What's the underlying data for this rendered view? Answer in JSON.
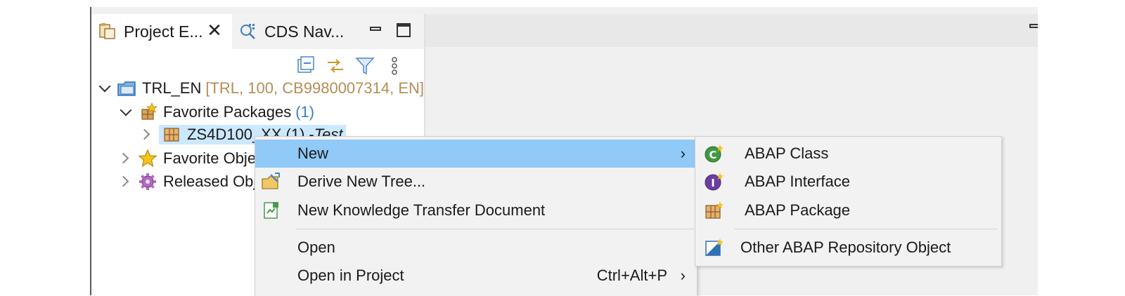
{
  "explorer": {
    "tabs": [
      {
        "label": "Project E...",
        "icon": "project-explorer-icon",
        "active": true
      },
      {
        "label": "CDS Nav...",
        "icon": "cds-navigator-icon",
        "active": false
      }
    ],
    "toolbar": [
      "collapse-all-icon",
      "link-with-editor-icon",
      "filter-icon",
      "view-menu-icon"
    ],
    "tree": {
      "root": {
        "name": "TRL_EN",
        "decoration": "[TRL, 100, CB9980007314, EN]",
        "icon": "abap-project-icon"
      },
      "favorite_packages": {
        "name": "Favorite Packages",
        "count": "(1)",
        "icon": "favorite-packages-icon"
      },
      "package": {
        "name": "ZS4D100_XX",
        "count": "(1)",
        "description": "Test",
        "icon": "package-icon"
      },
      "favorite_objects": {
        "name": "Favorite Obje",
        "icon": "star-icon"
      },
      "released_objects": {
        "name": "Released Obj",
        "icon": "released-objects-icon"
      }
    }
  },
  "context_menu": {
    "items": [
      {
        "label": "New",
        "has_submenu": true,
        "highlighted": true
      },
      {
        "label": "Derive New Tree...",
        "icon": "derive-tree-icon"
      },
      {
        "label": "New Knowledge Transfer Document",
        "icon": "knowledge-transfer-icon"
      },
      {
        "label": "Open"
      },
      {
        "label": "Open in Project",
        "accelerator": "Ctrl+Alt+P",
        "has_submenu": true
      }
    ]
  },
  "submenu": {
    "items": [
      {
        "label": "ABAP Class",
        "icon": "abap-class-icon"
      },
      {
        "label": "ABAP Interface",
        "icon": "abap-interface-icon"
      },
      {
        "label": "ABAP Package",
        "icon": "abap-package-icon"
      },
      {
        "label": "Other ABAP Repository Object",
        "icon": "abap-repository-object-icon"
      }
    ]
  },
  "colors": {
    "menu_highlight": "#91c9f7",
    "selection": "#cce8ff",
    "decoration": "#b58d55",
    "count": "#3b7fc4"
  }
}
